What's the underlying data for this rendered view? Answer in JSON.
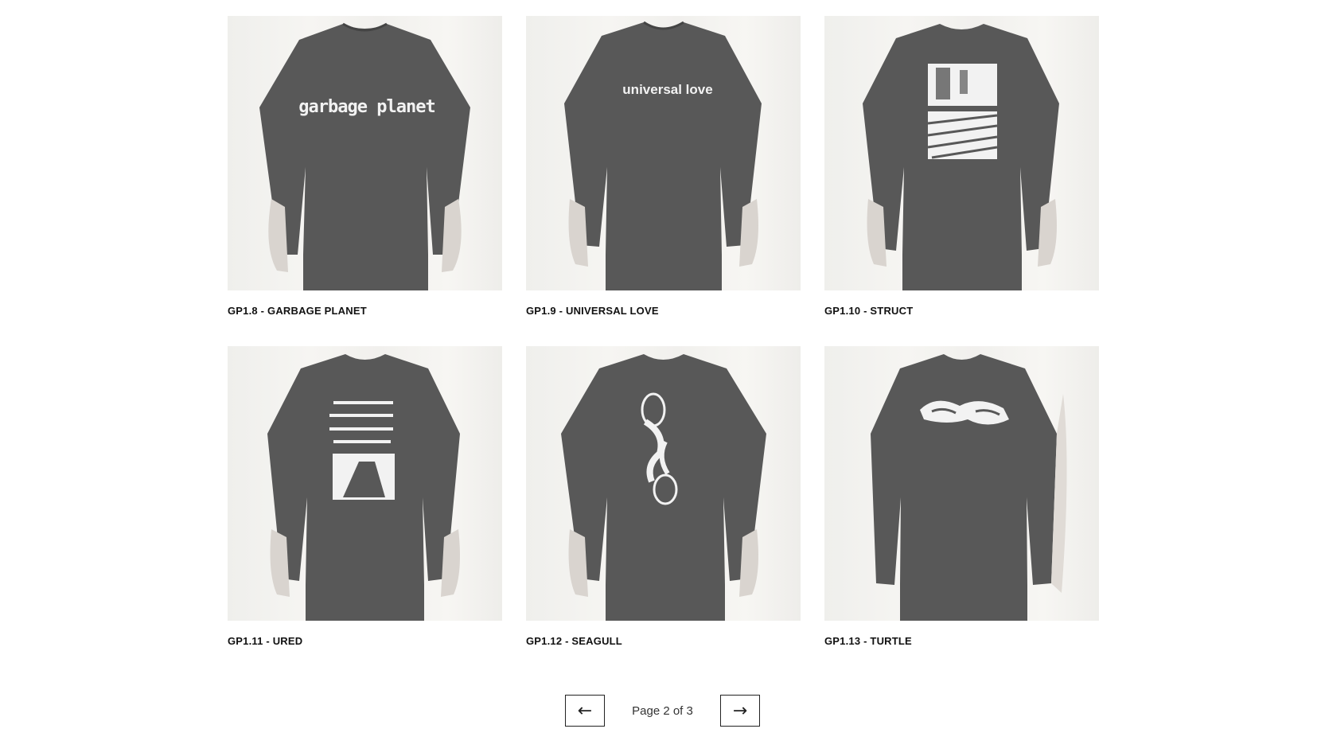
{
  "products": [
    {
      "title": "GP1.8 - GARBAGE PLANET",
      "print_text": "garbage planet",
      "print_style": "text-wide"
    },
    {
      "title": "GP1.9 - UNIVERSAL LOVE",
      "print_text": "universal love",
      "print_style": "text-small"
    },
    {
      "title": "GP1.10 - STRUCT",
      "print_text": "",
      "print_style": "struct"
    },
    {
      "title": "GP1.11 - URED",
      "print_text": "",
      "print_style": "ured"
    },
    {
      "title": "GP1.12 - SEAGULL",
      "print_text": "",
      "print_style": "seagull"
    },
    {
      "title": "GP1.13 - TURTLE",
      "print_text": "",
      "print_style": "turtle"
    }
  ],
  "pagination": {
    "prev_icon": "←",
    "next_icon": "→",
    "label": "Page 2 of 3"
  },
  "colors": {
    "shirt": "#585858",
    "background": "#f3f2ef",
    "print": "#f2f2f2",
    "title_text": "#111111"
  }
}
